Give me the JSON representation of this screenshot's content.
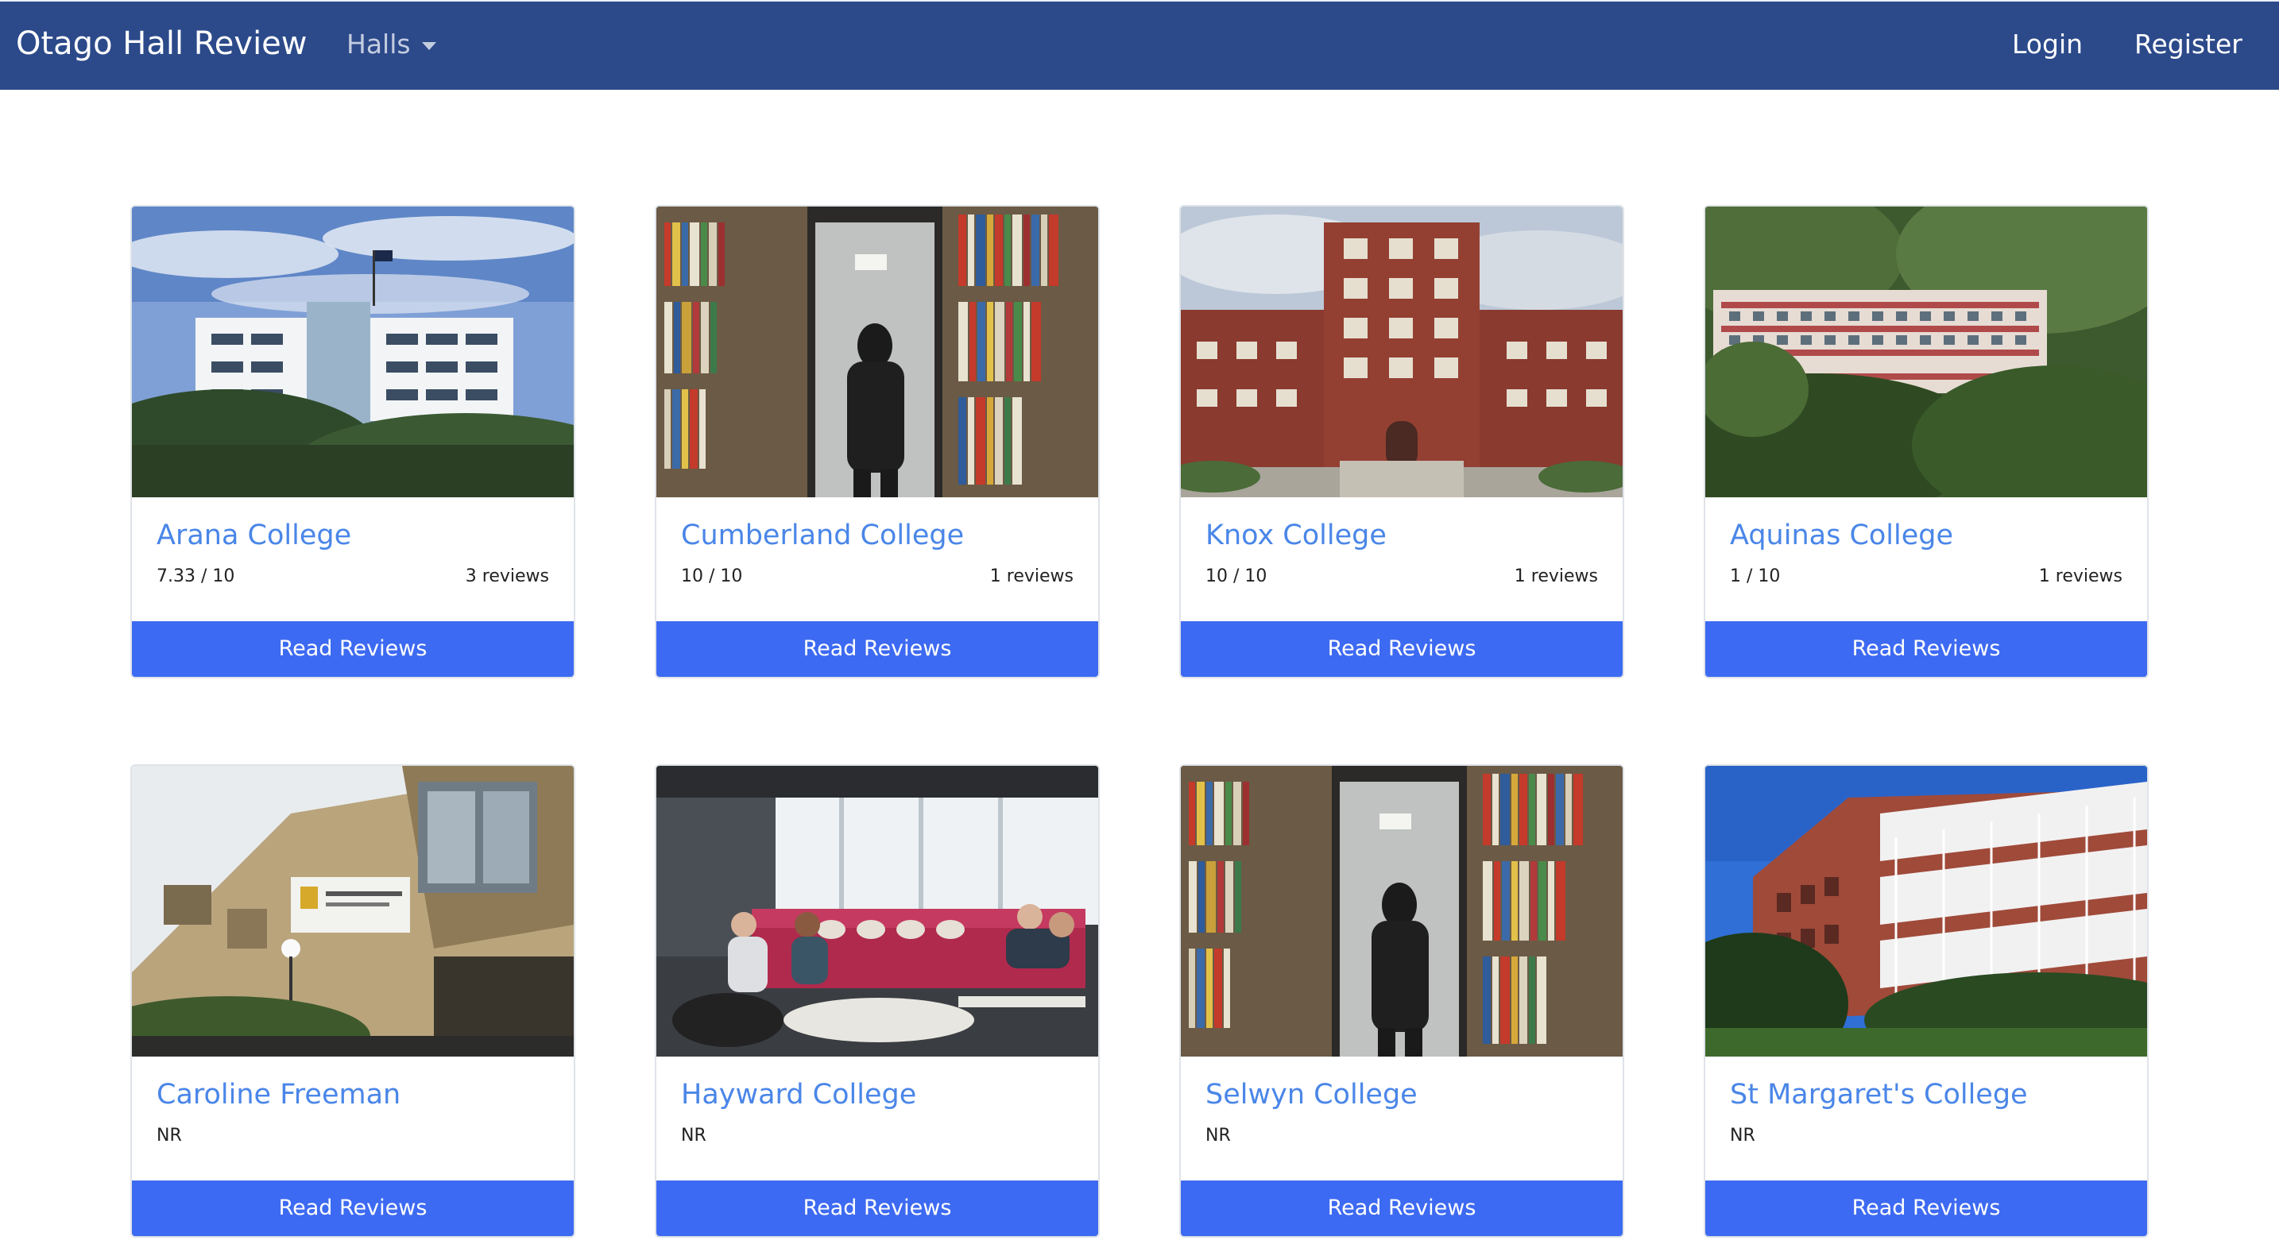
{
  "navbar": {
    "brand": "Otago Hall Review",
    "halls_label": "Halls",
    "login_label": "Login",
    "register_label": "Register"
  },
  "colors": {
    "navbar_bg": "#2c4a8a",
    "title_link": "#4a86e8",
    "button_bg": "#3d6af2"
  },
  "cards": [
    {
      "title": "Arana College",
      "rating": "7.33 / 10",
      "reviews": "3 reviews",
      "button": "Read Reviews"
    },
    {
      "title": "Cumberland College",
      "rating": "10 / 10",
      "reviews": "1 reviews",
      "button": "Read Reviews"
    },
    {
      "title": "Knox College",
      "rating": "10 / 10",
      "reviews": "1 reviews",
      "button": "Read Reviews"
    },
    {
      "title": "Aquinas College",
      "rating": "1 / 10",
      "reviews": "1 reviews",
      "button": "Read Reviews"
    },
    {
      "title": "Caroline Freeman",
      "rating": "NR",
      "button": "Read Reviews"
    },
    {
      "title": "Hayward College",
      "rating": "NR",
      "button": "Read Reviews"
    },
    {
      "title": "Selwyn College",
      "rating": "NR",
      "button": "Read Reviews"
    },
    {
      "title": "St Margaret's College",
      "rating": "NR",
      "button": "Read Reviews"
    }
  ]
}
